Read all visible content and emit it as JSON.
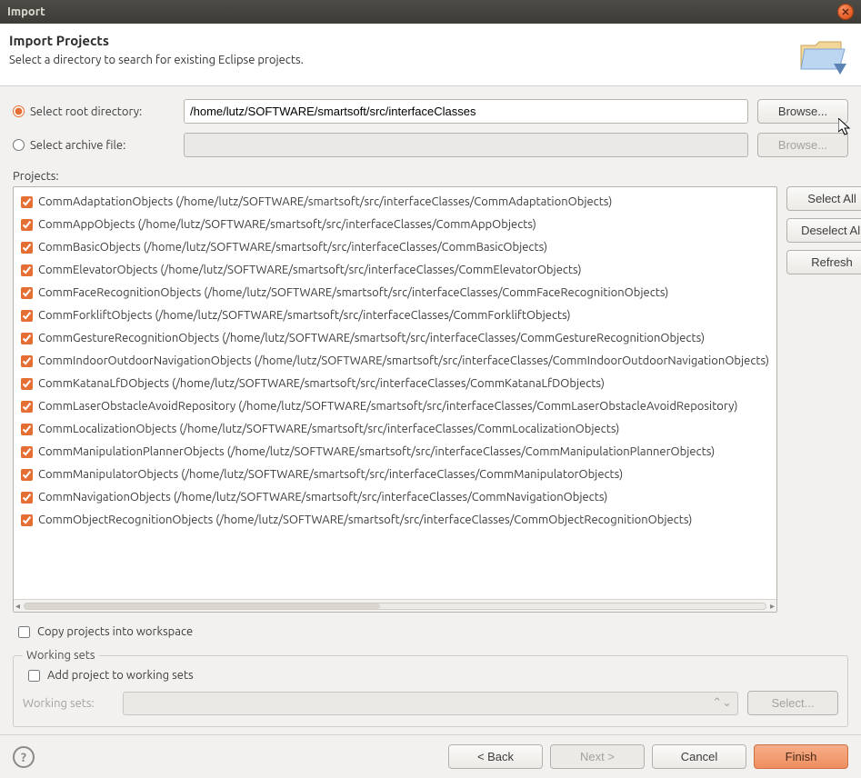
{
  "window": {
    "title": "Import"
  },
  "header": {
    "title": "Import Projects",
    "subtitle": "Select a directory to search for existing Eclipse projects."
  },
  "source": {
    "root_radio_label": "Select root directory:",
    "archive_radio_label": "Select archive file:",
    "root_path": "/home/lutz/SOFTWARE/smartsoft/src/interfaceClasses",
    "archive_path": "",
    "browse_label": "Browse...",
    "selected": "root"
  },
  "projects_label": "Projects:",
  "side": {
    "select_all": "Select All",
    "deselect_all": "Deselect All",
    "refresh": "Refresh"
  },
  "projects": [
    {
      "checked": true,
      "label": "CommAdaptationObjects (/home/lutz/SOFTWARE/smartsoft/src/interfaceClasses/CommAdaptationObjects)"
    },
    {
      "checked": true,
      "label": "CommAppObjects (/home/lutz/SOFTWARE/smartsoft/src/interfaceClasses/CommAppObjects)"
    },
    {
      "checked": true,
      "label": "CommBasicObjects (/home/lutz/SOFTWARE/smartsoft/src/interfaceClasses/CommBasicObjects)"
    },
    {
      "checked": true,
      "label": "CommElevatorObjects (/home/lutz/SOFTWARE/smartsoft/src/interfaceClasses/CommElevatorObjects)"
    },
    {
      "checked": true,
      "label": "CommFaceRecognitionObjects (/home/lutz/SOFTWARE/smartsoft/src/interfaceClasses/CommFaceRecognitionObjects)"
    },
    {
      "checked": true,
      "label": "CommForkliftObjects (/home/lutz/SOFTWARE/smartsoft/src/interfaceClasses/CommForkliftObjects)"
    },
    {
      "checked": true,
      "label": "CommGestureRecognitionObjects (/home/lutz/SOFTWARE/smartsoft/src/interfaceClasses/CommGestureRecognitionObjects)"
    },
    {
      "checked": true,
      "label": "CommIndoorOutdoorNavigationObjects (/home/lutz/SOFTWARE/smartsoft/src/interfaceClasses/CommIndoorOutdoorNavigationObjects)"
    },
    {
      "checked": true,
      "label": "CommKatanaLfDObjects (/home/lutz/SOFTWARE/smartsoft/src/interfaceClasses/CommKatanaLfDObjects)"
    },
    {
      "checked": true,
      "label": "CommLaserObstacleAvoidRepository (/home/lutz/SOFTWARE/smartsoft/src/interfaceClasses/CommLaserObstacleAvoidRepository)"
    },
    {
      "checked": true,
      "label": "CommLocalizationObjects (/home/lutz/SOFTWARE/smartsoft/src/interfaceClasses/CommLocalizationObjects)"
    },
    {
      "checked": true,
      "label": "CommManipulationPlannerObjects (/home/lutz/SOFTWARE/smartsoft/src/interfaceClasses/CommManipulationPlannerObjects)"
    },
    {
      "checked": true,
      "label": "CommManipulatorObjects (/home/lutz/SOFTWARE/smartsoft/src/interfaceClasses/CommManipulatorObjects)"
    },
    {
      "checked": true,
      "label": "CommNavigationObjects (/home/lutz/SOFTWARE/smartsoft/src/interfaceClasses/CommNavigationObjects)"
    },
    {
      "checked": true,
      "label": "CommObjectRecognitionObjects (/home/lutz/SOFTWARE/smartsoft/src/interfaceClasses/CommObjectRecognitionObjects)"
    }
  ],
  "options": {
    "copy_into_workspace_label": "Copy projects into workspace",
    "copy_into_workspace_checked": false
  },
  "working_sets": {
    "legend": "Working sets",
    "add_label": "Add project to working sets",
    "add_checked": false,
    "combo_label": "Working sets:",
    "select_label": "Select..."
  },
  "footer": {
    "back": "< Back",
    "next": "Next >",
    "cancel": "Cancel",
    "finish": "Finish"
  }
}
